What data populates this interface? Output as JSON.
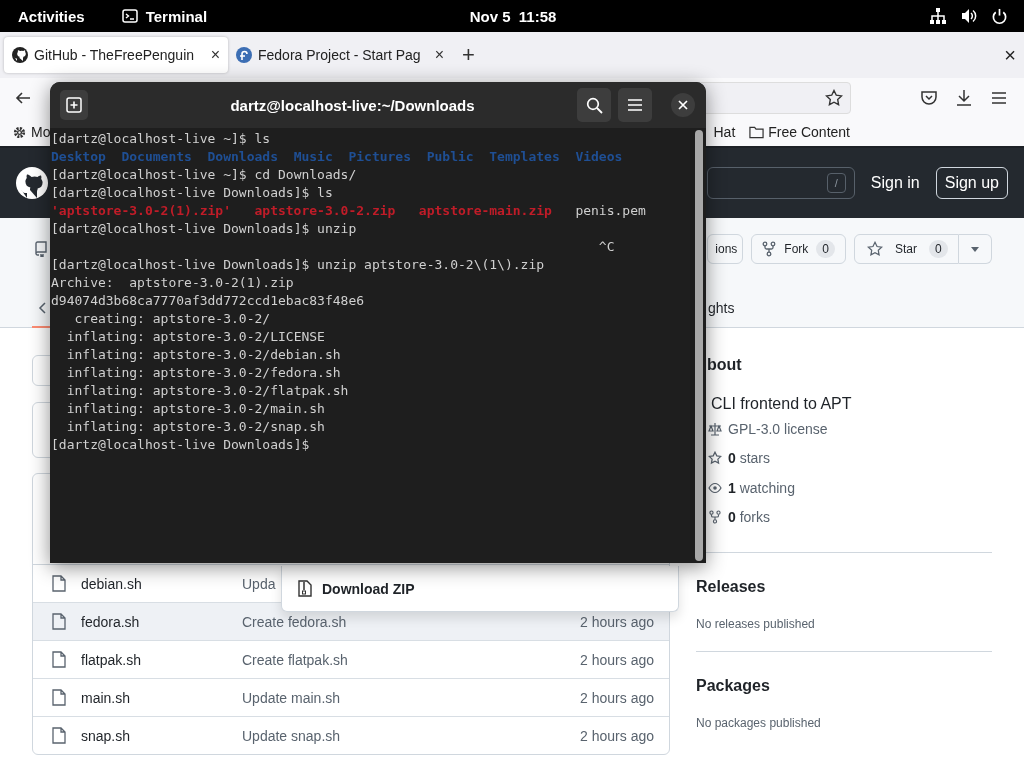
{
  "top_bar": {
    "activities": "Activities",
    "app": "Terminal",
    "clock": "Nov 5  11:58"
  },
  "browser": {
    "tabs": [
      {
        "title": "GitHub - TheFreePenguin",
        "selected": true,
        "close": "×",
        "kind": "github"
      },
      {
        "title": "Fedora Project - Start Pag",
        "selected": false,
        "close": "×",
        "kind": "fedora"
      }
    ],
    "new_tab": "+",
    "close_window": "×",
    "bookmarks": [
      {
        "label": "Mo",
        "kind": "gear"
      },
      {
        "label": "Hat",
        "kind": "plain"
      },
      {
        "label": "Free Content",
        "kind": "folder"
      }
    ]
  },
  "github": {
    "search_key": "/",
    "sign_in": "Sign in",
    "sign_up": "Sign up",
    "repo_actions": [
      {
        "label": "ions",
        "kind": "plain"
      },
      {
        "label": "Fork",
        "count": "0",
        "kind": "fork"
      },
      {
        "label": "Star",
        "count": "0",
        "kind": "star"
      }
    ],
    "insights_label": "ghts",
    "files": [
      {
        "name": "debian.sh",
        "commit": "Upda",
        "selected": false
      },
      {
        "name": "fedora.sh",
        "commit": "Create fedora.sh",
        "time": "2 hours ago",
        "selected": true
      },
      {
        "name": "flatpak.sh",
        "commit": "Create flatpak.sh",
        "time": "2 hours ago",
        "selected": false
      },
      {
        "name": "main.sh",
        "commit": "Update main.sh",
        "time": "2 hours ago",
        "selected": false
      },
      {
        "name": "snap.sh",
        "commit": "Update snap.sh",
        "time": "2 hours ago",
        "selected": false
      }
    ],
    "about": {
      "heading": "bout",
      "description": "CLI frontend to APT",
      "stats": [
        {
          "kind": "license",
          "text": "GPL-3.0 license"
        },
        {
          "kind": "star",
          "text": "**0** stars"
        },
        {
          "kind": "eye",
          "text": "**1** watching"
        },
        {
          "kind": "fork",
          "text": "**0** forks"
        }
      ]
    },
    "releases": {
      "heading": "Releases",
      "note": "No releases published"
    },
    "packages": {
      "heading": "Packages",
      "note": "No packages published"
    },
    "download_menu": {
      "item": "Download ZIP"
    }
  },
  "terminal": {
    "title": "dartz@localhost-live:~/Downloads",
    "lines": [
      {
        "kind": "text",
        "text": "[dartz@localhost-live ~]$ ls"
      },
      {
        "kind": "dirs",
        "items": [
          {
            "text": "Desktop",
            "color": "#1f4f94"
          },
          {
            "text": "Documents",
            "color": "#1f4f94"
          },
          {
            "text": "Downloads",
            "color": "#1f4f94"
          },
          {
            "text": "Music",
            "color": "#1f4f94"
          },
          {
            "text": "Pictures",
            "color": "#1f4f94"
          },
          {
            "text": "Public",
            "color": "#1f4f94"
          },
          {
            "text": "Templates",
            "color": "#1f4f94"
          },
          {
            "text": "Videos",
            "color": "#1f4f94"
          }
        ]
      },
      {
        "kind": "text",
        "text": "[dartz@localhost-live ~]$ cd Downloads/"
      },
      {
        "kind": "text",
        "text": "[dartz@localhost-live Downloads]$ ls"
      },
      {
        "kind": "files",
        "items": [
          {
            "text": "'aptstore-3.0-2(1).zip'",
            "color": "#c01c28"
          },
          {
            "text": "aptstore-3.0-2.zip",
            "color": "#c01c28"
          },
          {
            "text": "aptstore-main.zip",
            "color": "#c01c28"
          },
          {
            "text": "penis.pem",
            "color": "#d0d0d0"
          }
        ]
      },
      {
        "kind": "text",
        "text": "[dartz@localhost-live Downloads]$ unzip"
      },
      {
        "kind": "interrupt",
        "text": "^C"
      },
      {
        "kind": "text",
        "text": "[dartz@localhost-live Downloads]$ unzip aptstore-3.0-2\\(1\\).zip"
      },
      {
        "kind": "text",
        "text": "Archive:  aptstore-3.0-2(1).zip"
      },
      {
        "kind": "text",
        "text": "d94074d3b68ca7770af3dd772ccd1ebac83f48e6"
      },
      {
        "kind": "text",
        "text": "   creating: aptstore-3.0-2/"
      },
      {
        "kind": "text",
        "text": "  inflating: aptstore-3.0-2/LICENSE"
      },
      {
        "kind": "text",
        "text": "  inflating: aptstore-3.0-2/debian.sh"
      },
      {
        "kind": "text",
        "text": "  inflating: aptstore-3.0-2/fedora.sh"
      },
      {
        "kind": "text",
        "text": "  inflating: aptstore-3.0-2/flatpak.sh"
      },
      {
        "kind": "text",
        "text": "  inflating: aptstore-3.0-2/main.sh"
      },
      {
        "kind": "text",
        "text": "  inflating: aptstore-3.0-2/snap.sh"
      },
      {
        "kind": "text",
        "text": "[dartz@localhost-live Downloads]$"
      }
    ]
  }
}
